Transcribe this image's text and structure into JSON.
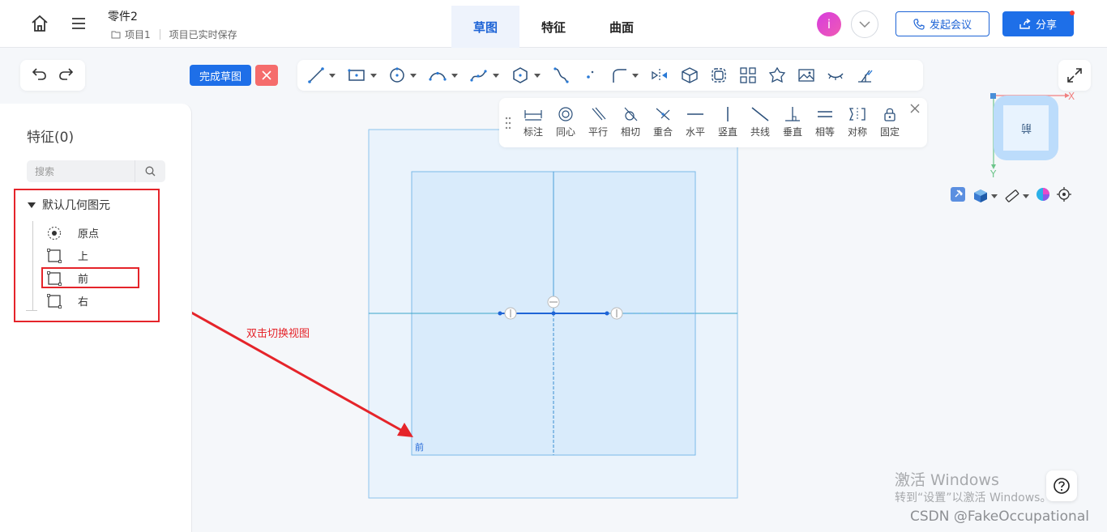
{
  "header": {
    "doc_title": "零件2",
    "project": "项目1",
    "save_status": "项目已实时保存",
    "tabs": [
      {
        "label": "草图",
        "active": true
      },
      {
        "label": "特征",
        "active": false
      },
      {
        "label": "曲面",
        "active": false
      }
    ],
    "avatar_letter": "i",
    "meeting_label": "发起会议",
    "share_label": "分享"
  },
  "sketch": {
    "finish_label": "完成草图"
  },
  "constraints": [
    {
      "label": "标注",
      "icon": "dimension-icon"
    },
    {
      "label": "同心",
      "icon": "concentric-icon"
    },
    {
      "label": "平行",
      "icon": "parallel-icon"
    },
    {
      "label": "相切",
      "icon": "tangent-icon"
    },
    {
      "label": "重合",
      "icon": "coincident-icon"
    },
    {
      "label": "水平",
      "icon": "horizontal-icon"
    },
    {
      "label": "竖直",
      "icon": "vertical-icon"
    },
    {
      "label": "共线",
      "icon": "collinear-icon"
    },
    {
      "label": "垂直",
      "icon": "perpendicular-icon"
    },
    {
      "label": "相等",
      "icon": "equal-icon"
    },
    {
      "label": "对称",
      "icon": "symmetric-icon"
    },
    {
      "label": "固定",
      "icon": "lock-icon"
    }
  ],
  "sidebar": {
    "title": "特征(0)",
    "search_placeholder": "搜索",
    "group_label": "默认几何图元",
    "items": [
      {
        "label": "原点",
        "icon": "origin-icon"
      },
      {
        "label": "上",
        "icon": "plane-icon"
      },
      {
        "label": "前",
        "icon": "plane-icon"
      },
      {
        "label": "右",
        "icon": "plane-icon"
      }
    ]
  },
  "annotation": {
    "text": "双击切换视图"
  },
  "viewcube": {
    "x_label": "X",
    "y_label": "Y"
  },
  "watermark": {
    "line1": "激活 Windows",
    "line2": "转到“设置”以激活 Windows。",
    "csdn": "CSDN @FakeOccupational"
  },
  "colors": {
    "accent": "#1e6fe8",
    "highlight": "#e5242a",
    "plane_fill": "#dcecfc",
    "plane_stroke": "#7ab8e8"
  }
}
